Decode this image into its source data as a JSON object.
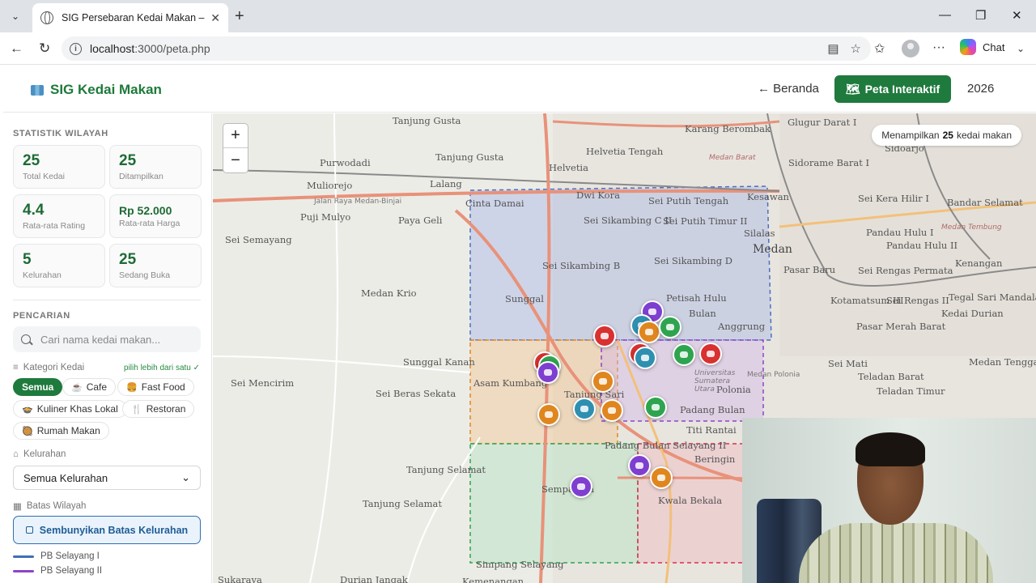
{
  "browser": {
    "tab_title": "SIG Persebaran Kedai Makan – Ked",
    "url_host": "localhost",
    "url_path": ":3000/peta.php",
    "chat_label": "Chat"
  },
  "header": {
    "brand": "SIG Kedai Makan",
    "nav_home": "← Beranda",
    "nav_map": "Peta Interaktif",
    "year": "2026"
  },
  "sidebar": {
    "stats_title": "STATISTIK WILAYAH",
    "stats": [
      {
        "value": "25",
        "label": "Total Kedai"
      },
      {
        "value": "25",
        "label": "Ditampilkan"
      },
      {
        "value": "4.4",
        "label": "Rata-rata Rating"
      },
      {
        "value": "Rp 52.000",
        "label": "Rata-rata Harga"
      },
      {
        "value": "5",
        "label": "Kelurahan"
      },
      {
        "value": "25",
        "label": "Sedang Buka"
      }
    ],
    "search_title": "PENCARIAN",
    "search_placeholder": "Cari nama kedai makan...",
    "category_label": "Kategori Kedai",
    "category_hint": "pilih lebih dari satu ✓",
    "categories": [
      {
        "label": "Semua",
        "icon": ""
      },
      {
        "label": "Cafe",
        "icon": "coffee-icon"
      },
      {
        "label": "Fast Food",
        "icon": "burger-icon"
      },
      {
        "label": "Kuliner Khas Lokal",
        "icon": "bowl-icon"
      },
      {
        "label": "Restoran",
        "icon": "cutlery-icon"
      },
      {
        "label": "Rumah Makan",
        "icon": "pot-icon"
      }
    ],
    "kelurahan_label": "Kelurahan",
    "kelurahan_selected": "Semua Kelurahan",
    "boundary_label": "Batas Wilayah",
    "boundary_button": "Sembunyikan Batas Kelurahan",
    "legend": [
      {
        "name": "PB Selayang I",
        "color": "#3f6fb5"
      },
      {
        "name": "PB Selayang II",
        "color": "#8e44c9"
      }
    ]
  },
  "map": {
    "counter_prefix": "Menampilkan",
    "counter_count": "25",
    "counter_suffix": "kedai makan",
    "zoom_in": "+",
    "zoom_out": "−",
    "labels": [
      "Tanjung Gusta",
      "Karang Berombak",
      "Glugur Darat I",
      "Sidoarjo",
      "Purwodadi",
      "Tanjung Gusta",
      "Helvetia",
      "Helvetia Tengah",
      "Sidorame Barat I",
      "Muliorejo",
      "Lalang",
      "Cinta Damai",
      "Dwi Kora",
      "Sei Putih Tengah",
      "Kesawan",
      "Sei Kera Hilir I",
      "Bandar Selamat",
      "Puji Mulyo",
      "Paya Geli",
      "Sei Sikambing C II",
      "Sei Putih Timur II",
      "Silalas",
      "Pandau Hulu I",
      "Sei Semayang",
      "Medan",
      "Sei Sikambing B",
      "Sei Sikambing D",
      "Pasar Baru",
      "Sei Rengas Permata",
      "Kenangan",
      "Medan Krio",
      "Sunggal",
      "Petisah Hulu",
      "Kotamatsum III",
      "Sei Rengas II",
      "Tegal Sari Mandala III",
      "Bulan",
      "Anggrung",
      "Pasar Merah Barat",
      "Sunggal Kanan",
      "Sei Mati",
      "Teladan Barat",
      "Medan Polonia",
      "Sei Mencirim",
      "Asam Kumbang",
      "Sei Beras Sekata",
      "Tanjung Sari",
      "Polonia",
      "Padang Bulan",
      "Titi Rantai",
      "Padang Bulan Selayang II",
      "Beringin",
      "Tanjung Selamat",
      "Sempakata",
      "Tanjung Selamat",
      "Kwala Bekala",
      "Simpang Selayang",
      "Sukaraya",
      "Durian Jangak",
      "Kemenangan",
      "Universitas Sumatera Utara",
      "Jalan Raya Medan-Binjai",
      "Medan Barat",
      "Medan Tembung",
      "Teladan Timur",
      "Medan Tenggara",
      "Pandau Hulu II",
      "Kedai Durian"
    ],
    "markers": [
      {
        "category": "Cafe",
        "color": "#7e3fd0"
      },
      {
        "category": "Cafe",
        "color": "#2e8fb0"
      },
      {
        "category": "Kuliner Khas Lokal",
        "color": "#e0861f"
      },
      {
        "category": "Fast Food",
        "color": "#2ea44f"
      },
      {
        "category": "Fast Food",
        "color": "#d93030"
      },
      {
        "category": "Cafe",
        "color": "#d93030"
      },
      {
        "category": "Cafe",
        "color": "#2e8fb0"
      },
      {
        "category": "Fast Food",
        "color": "#2ea44f"
      },
      {
        "category": "Fast Food",
        "color": "#d93030"
      },
      {
        "category": "Fast Food",
        "color": "#d93030"
      },
      {
        "category": "Fast Food",
        "color": "#2ea44f"
      },
      {
        "category": "Restoran",
        "color": "#7e3fd0"
      },
      {
        "category": "Kuliner Khas Lokal",
        "color": "#e0861f"
      },
      {
        "category": "Kuliner Khas Lokal",
        "color": "#e0861f"
      },
      {
        "category": "Cafe",
        "color": "#2e8fb0"
      },
      {
        "category": "Kuliner Khas Lokal",
        "color": "#e0861f"
      },
      {
        "category": "Fast Food",
        "color": "#2ea44f"
      },
      {
        "category": "Restoran",
        "color": "#7e3fd0"
      },
      {
        "category": "Kuliner Khas Lokal",
        "color": "#e0861f"
      },
      {
        "category": "Restoran",
        "color": "#7e3fd0"
      }
    ]
  }
}
